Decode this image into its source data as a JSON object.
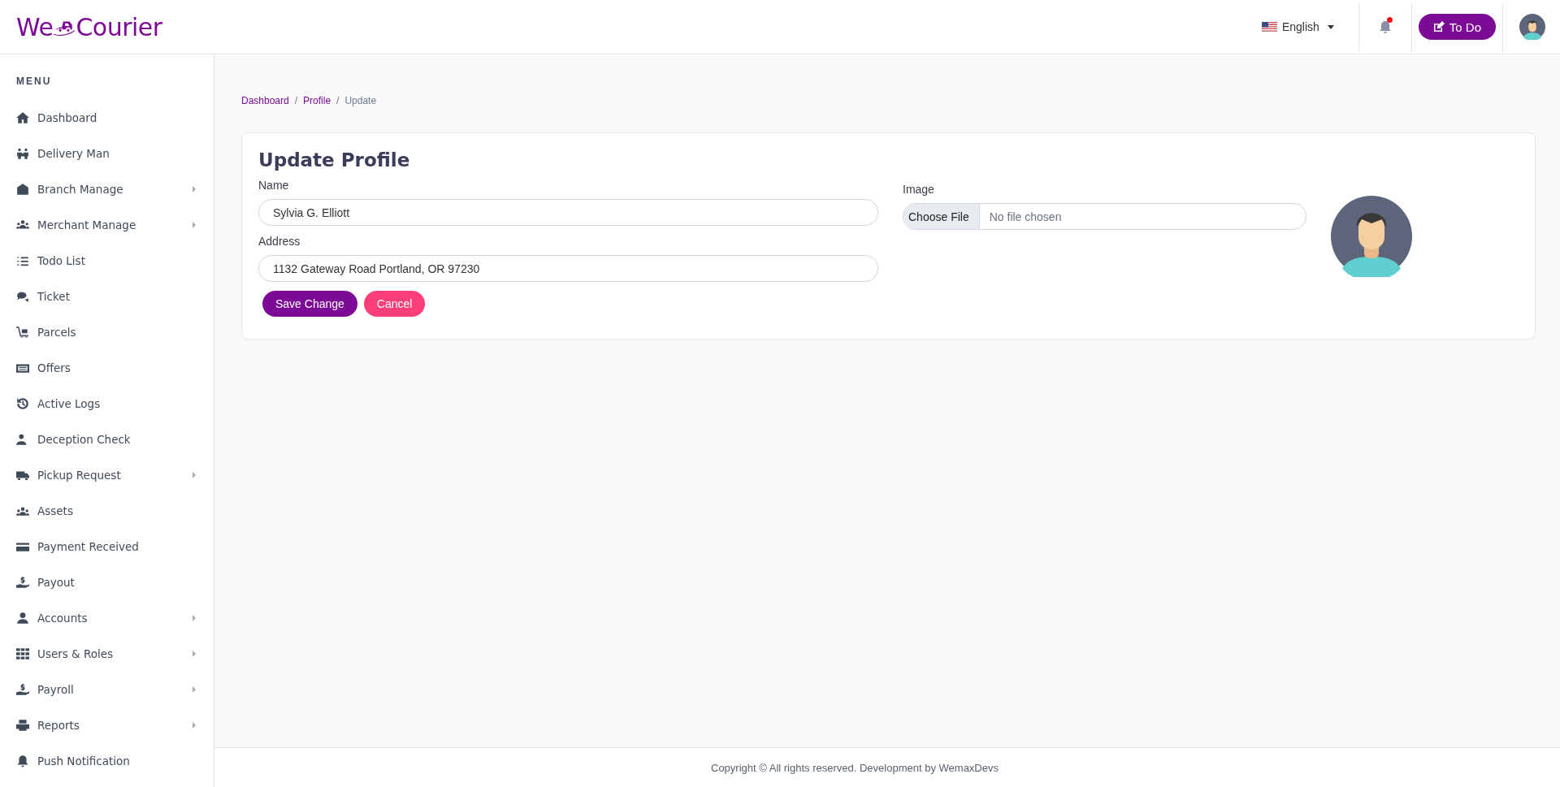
{
  "header": {
    "logo": {
      "left": "We",
      "right": "Courier"
    },
    "language": "English",
    "todo_button": "To Do",
    "notification_unread": true
  },
  "sidebar": {
    "heading": "MENU",
    "items": [
      {
        "label": "Dashboard",
        "has_submenu": false
      },
      {
        "label": "Delivery Man",
        "has_submenu": false
      },
      {
        "label": "Branch Manage",
        "has_submenu": true
      },
      {
        "label": "Merchant Manage",
        "has_submenu": true
      },
      {
        "label": "Todo List",
        "has_submenu": false
      },
      {
        "label": "Ticket",
        "has_submenu": false
      },
      {
        "label": "Parcels",
        "has_submenu": false
      },
      {
        "label": "Offers",
        "has_submenu": false
      },
      {
        "label": "Active Logs",
        "has_submenu": false
      },
      {
        "label": "Deception Check",
        "has_submenu": false
      },
      {
        "label": "Pickup Request",
        "has_submenu": true
      },
      {
        "label": "Assets",
        "has_submenu": false
      },
      {
        "label": "Payment Received",
        "has_submenu": false
      },
      {
        "label": "Payout",
        "has_submenu": false
      },
      {
        "label": "Accounts",
        "has_submenu": true
      },
      {
        "label": "Users & Roles",
        "has_submenu": true
      },
      {
        "label": "Payroll",
        "has_submenu": true
      },
      {
        "label": "Reports",
        "has_submenu": true
      },
      {
        "label": "Push Notification",
        "has_submenu": false
      }
    ]
  },
  "breadcrumb_separator": "/",
  "breadcrumb": [
    {
      "label": "Dashboard",
      "link": true
    },
    {
      "label": "Profile",
      "link": true
    },
    {
      "label": "Update",
      "link": false
    }
  ],
  "form": {
    "title": "Update Profile",
    "fields": [
      {
        "label": "Name",
        "value": "Sylvia G. Elliott"
      },
      {
        "label": "Address",
        "value": "1132 Gateway Road Portland, OR 97230"
      }
    ],
    "image": {
      "label": "Image",
      "button": "Choose File",
      "status": "No file chosen"
    },
    "buttons": [
      {
        "label": "Save Change",
        "kind": "primary"
      },
      {
        "label": "Cancel",
        "kind": "danger"
      }
    ]
  },
  "footer": "Copyright © All rights reserved. Development by WemaxDevs"
}
